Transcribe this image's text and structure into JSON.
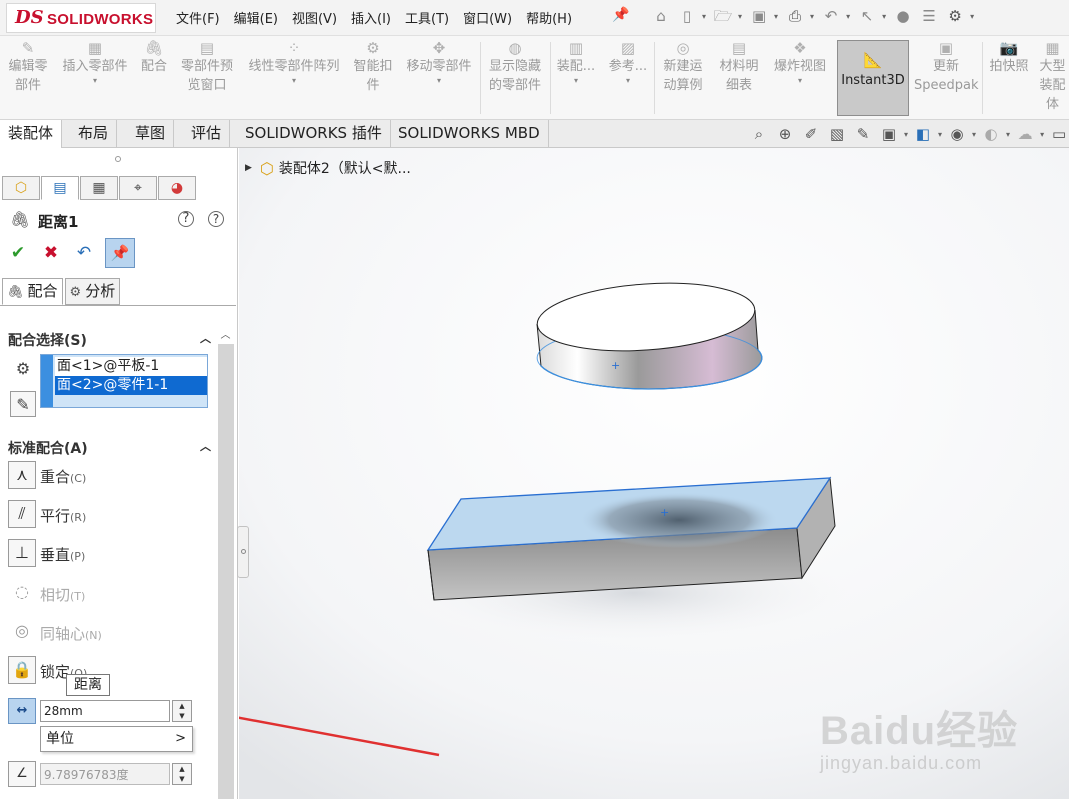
{
  "app": {
    "logo_prefix": "DS",
    "logo_text": "SOLIDWORKS"
  },
  "menu": {
    "items": [
      "文件(F)",
      "编辑(E)",
      "视图(V)",
      "插入(I)",
      "工具(T)",
      "窗口(W)",
      "帮助(H)"
    ]
  },
  "command_manager": {
    "items": [
      {
        "label": "编辑零部件"
      },
      {
        "label": "插入零部件"
      },
      {
        "label": "配合"
      },
      {
        "label": "零部件预览窗口"
      },
      {
        "label": "线性零部件阵列"
      },
      {
        "label": "智能扣件"
      },
      {
        "label": "移动零部件"
      },
      {
        "label": "显示隐藏的零部件"
      },
      {
        "label": "装配..."
      },
      {
        "label": "参考..."
      },
      {
        "label": "新建运动算例"
      },
      {
        "label": "材料明细表"
      },
      {
        "label": "爆炸视图"
      },
      {
        "label": "Instant3D"
      },
      {
        "label": "更新Speedpak"
      },
      {
        "label": "拍快照"
      },
      {
        "label": "大型装配体"
      }
    ]
  },
  "tabs": [
    "装配体",
    "布局",
    "草图",
    "评估",
    "SOLIDWORKS 插件",
    "SOLIDWORKS MBD"
  ],
  "property_manager": {
    "title": "距离1",
    "subtabs": [
      "配合",
      "分析"
    ],
    "mate_selection": {
      "heading": "配合选择(S)",
      "items": [
        "面<1>@平板-1",
        "面<2>@零件1-1"
      ]
    },
    "standard_mates": {
      "heading": "标准配合(A)",
      "items": [
        {
          "label": "重合",
          "key": "(C)"
        },
        {
          "label": "平行",
          "key": "(R)"
        },
        {
          "label": "垂直",
          "key": "(P)"
        },
        {
          "label": "相切",
          "key": "(T)"
        },
        {
          "label": "同轴心",
          "key": "(N)"
        },
        {
          "label": "锁定",
          "key": "(O)"
        }
      ]
    },
    "tooltip": "距离",
    "distance_value": "28mm",
    "unit_menu": "单位",
    "angle_value": "9.78976783度"
  },
  "feature_tree": {
    "root": "装配体2（默认<默..."
  },
  "watermark": {
    "text": "Baidu经验",
    "url": "jingyan.baidu.com"
  },
  "colors": {
    "accent": "#0f6ad1",
    "brand_red": "#c8102e",
    "highlight_face": "#bcd8ef",
    "ok_green": "#2c9a2c"
  }
}
